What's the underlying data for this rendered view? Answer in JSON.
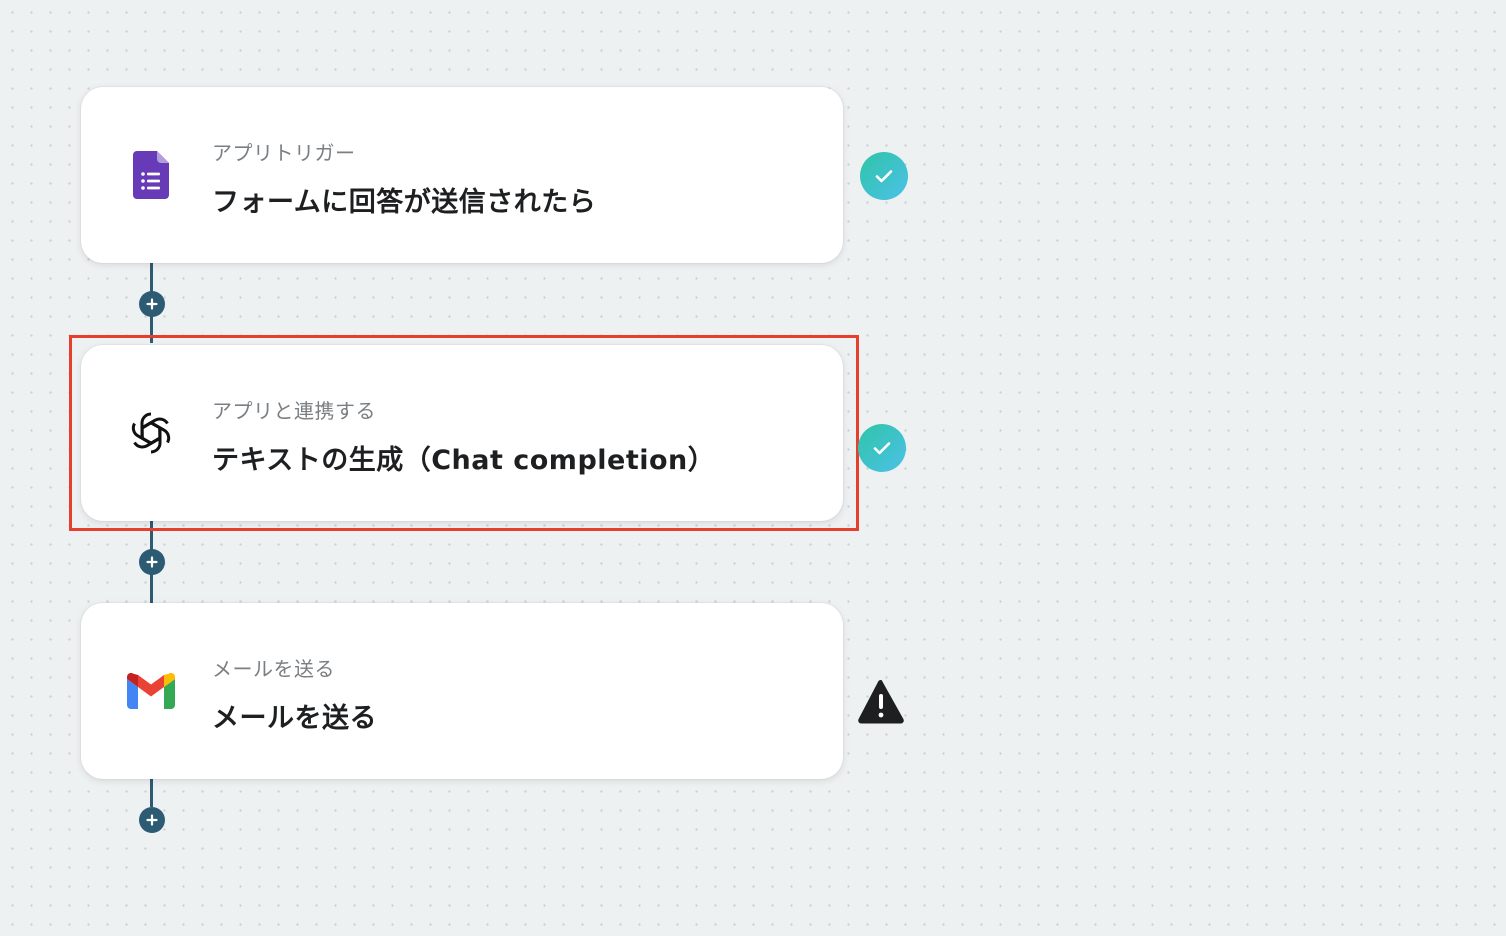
{
  "steps": [
    {
      "subtitle": "アプリトリガー",
      "title": "フォームに回答が送信されたら",
      "icon": "google-forms-icon",
      "status": "check-icon"
    },
    {
      "subtitle": "アプリと連携する",
      "title": "テキストの生成（Chat completion）",
      "icon": "openai-icon",
      "status": "check-icon",
      "highlighted": true
    },
    {
      "subtitle": "メールを送る",
      "title": "メールを送る",
      "icon": "gmail-icon",
      "status": "warning-icon"
    }
  ],
  "colors": {
    "background": "#eef1f2",
    "connector": "#2d5b73",
    "highlight_border": "#e5402e",
    "check_gradient_start": "#2fc4a8",
    "check_gradient_end": "#4cc1e8",
    "forms_purple": "#673ab7",
    "warning": "#1d1f21"
  }
}
